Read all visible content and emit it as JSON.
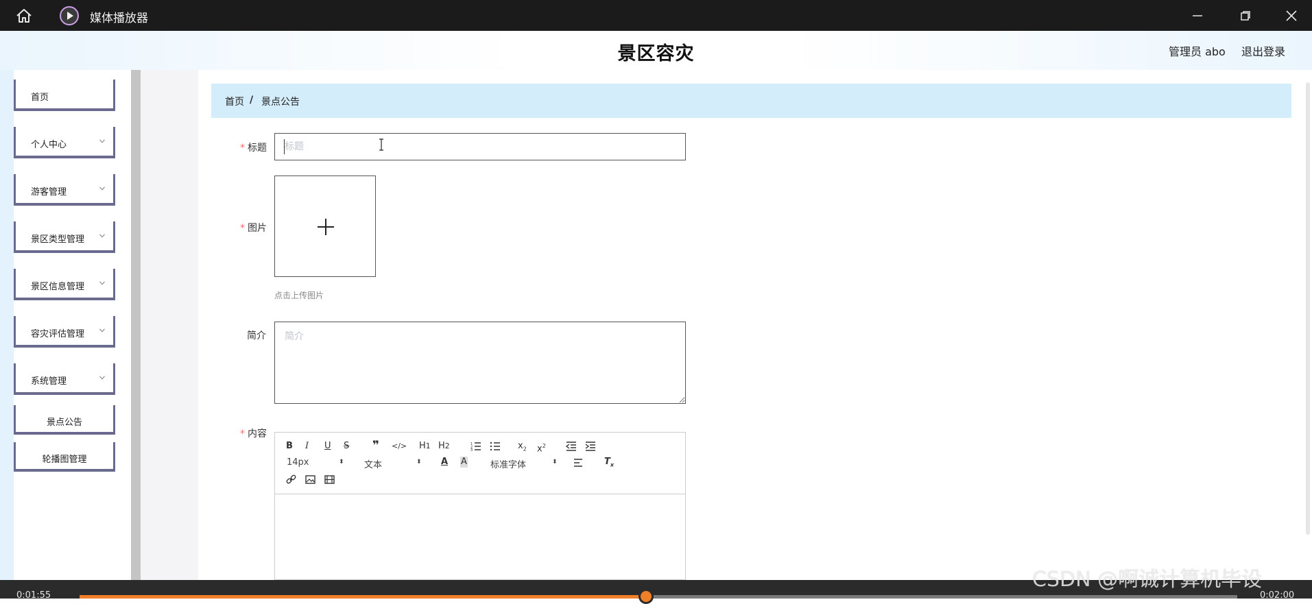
{
  "player": {
    "app_title": "媒体播放器",
    "current_time": "0:01:55",
    "total_time": "0:02:00",
    "progress_fraction": 0.49,
    "watermark": "CSDN @啊诚计算机毕设"
  },
  "header": {
    "site_title": "景区容灾",
    "user_label": "管理员 abo",
    "logout_label": "退出登录"
  },
  "sidebar": {
    "items": [
      {
        "label": "首页",
        "has_submenu": false
      },
      {
        "label": "个人中心",
        "has_submenu": true
      },
      {
        "label": "游客管理",
        "has_submenu": true
      },
      {
        "label": "景区类型管理",
        "has_submenu": true
      },
      {
        "label": "景区信息管理",
        "has_submenu": true
      },
      {
        "label": "容灾评估管理",
        "has_submenu": true
      },
      {
        "label": "系统管理",
        "has_submenu": true
      },
      {
        "label": "景点公告",
        "has_submenu": false
      },
      {
        "label": "轮播图管理",
        "has_submenu": false
      }
    ]
  },
  "breadcrumb": {
    "home": "首页",
    "separator": "/",
    "current": "景点公告"
  },
  "form": {
    "title_label": "标题",
    "title_placeholder": "标题",
    "title_value": "",
    "image_label": "图片",
    "upload_tip": "点击上传图片",
    "brief_label": "简介",
    "brief_placeholder": "简介",
    "content_label": "内容"
  },
  "editor": {
    "font_size": "14px",
    "header_select": "文本",
    "font_select": "标准字体"
  },
  "colors": {
    "accent_orange": "#f07f28",
    "breadcrumb_bg": "#d4edfb",
    "required_star": "#f56c6c",
    "menu_border": "#6a6a8e"
  }
}
